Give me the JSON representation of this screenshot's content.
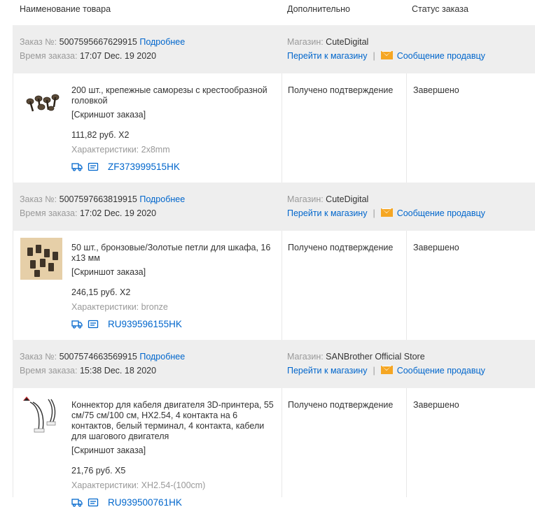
{
  "columns": {
    "name": "Наименование товара",
    "extra": "Дополнительно",
    "status": "Статус заказа"
  },
  "labels": {
    "order_no": "Заказ №: ",
    "order_time": "Время заказа: ",
    "details": "Подробнее",
    "store": "Магазин: ",
    "go_to_store": "Перейти к магазину",
    "separator": "|",
    "message_seller": "Сообщение продавцу",
    "snapshot": "[Скриншот заказа]",
    "spec_prefix": "Характеристики: "
  },
  "orders": [
    {
      "number": "5007595667629915",
      "time": "17:07 Dec. 19 2020",
      "store_name": "CuteDigital",
      "title": "200 шт., крепежные саморезы с крестообразной головкой",
      "price": "111,82 руб. X2",
      "spec": "2x8mm",
      "tracking": "ZF373999515HK",
      "extra": "Получено подтверждение",
      "status": "Завершено",
      "thumb_icon": "screws-thumbnail"
    },
    {
      "number": "5007597663819915",
      "time": "17:02 Dec. 19 2020",
      "store_name": "CuteDigital",
      "title": "50 шт., бронзовые/Золотые петли для шкафа, 16 x13 мм",
      "price": "246,15 руб. X2",
      "spec": "bronze",
      "tracking": "RU939596155HK",
      "extra": "Получено подтверждение",
      "status": "Завершено",
      "thumb_icon": "hinges-thumbnail"
    },
    {
      "number": "5007574663569915",
      "time": "15:38 Dec. 18 2020",
      "store_name": "SANBrother Official Store",
      "title": "Коннектор для кабеля двигателя 3D-принтера, 55 см/75 см/100 см, HX2.54, 4 контакта на 6 контактов, белый терминал, 4 контакта, кабели для шагового двигателя",
      "price": "21,76 руб. X5",
      "spec": "XH2.54-(100cm)",
      "tracking": "RU939500761HK",
      "extra": "Получено подтверждение",
      "status": "Завершено",
      "thumb_icon": "cable-thumbnail"
    }
  ],
  "colors": {
    "link": "#0066cc",
    "header_bg": "#eeeeee",
    "mail_icon": "#f5a623",
    "muted": "#999999"
  }
}
